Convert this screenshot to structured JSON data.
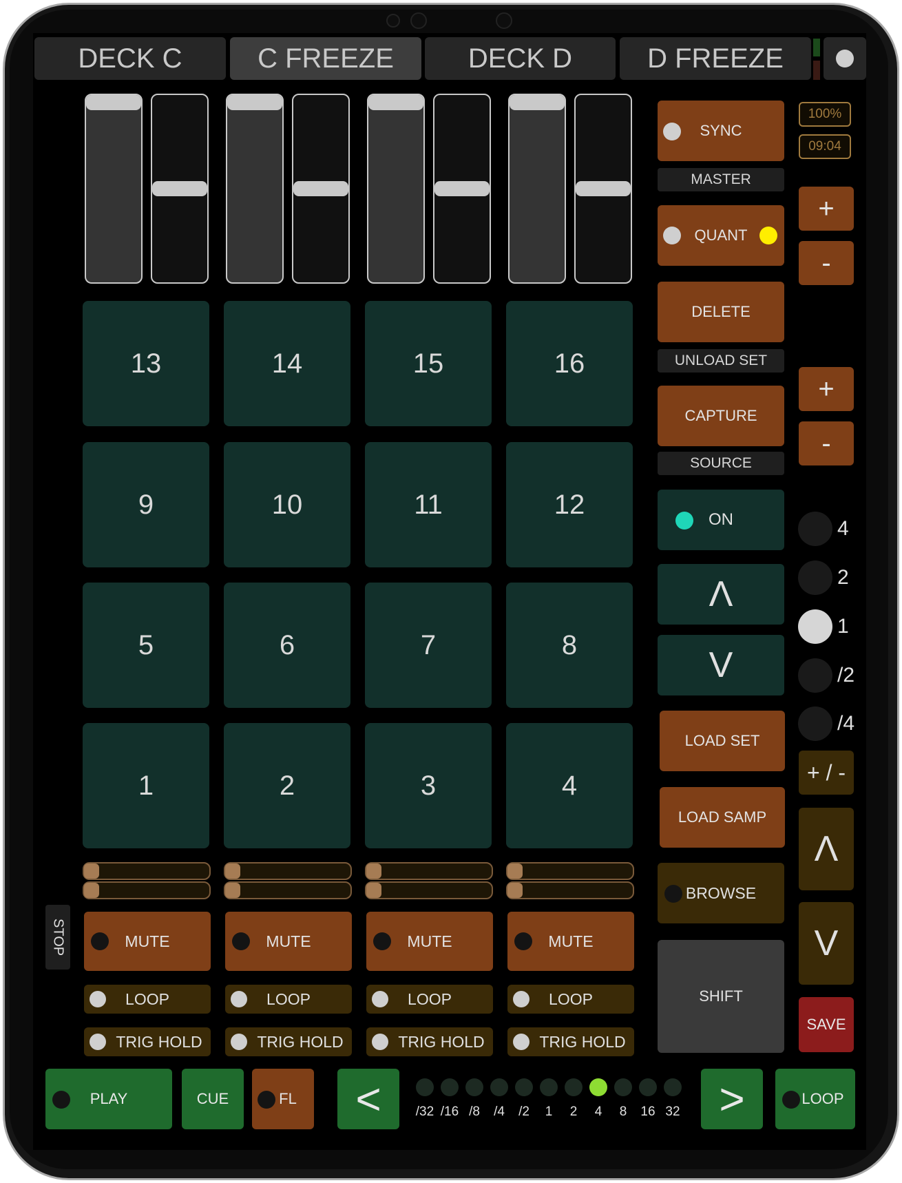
{
  "tabs": [
    {
      "label": "DECK C",
      "active": false
    },
    {
      "label": "C FREEZE",
      "active": true
    },
    {
      "label": "DECK D",
      "active": false
    },
    {
      "label": "D FREEZE",
      "active": false
    }
  ],
  "faders": {
    "levels": [
      1.0,
      0.5,
      1.0,
      0.5,
      1.0,
      0.5,
      1.0,
      0.5
    ]
  },
  "pads": {
    "rows": [
      [
        "13",
        "14",
        "15",
        "16"
      ],
      [
        "9",
        "10",
        "11",
        "12"
      ],
      [
        "5",
        "6",
        "7",
        "8"
      ],
      [
        "1",
        "2",
        "3",
        "4"
      ]
    ]
  },
  "slots": {
    "mute_label": "MUTE",
    "loop_label": "LOOP",
    "trig_hold_label": "TRIG HOLD",
    "stop_label": "STOP"
  },
  "right_panel": {
    "sync": "SYNC",
    "master": "MASTER",
    "quant": "QUANT",
    "delete": "DELETE",
    "unload_set": "UNLOAD SET",
    "capture": "CAPTURE",
    "source": "SOURCE",
    "on": "ON",
    "up_arrow": "Λ",
    "down_arrow": "V",
    "load_set": "LOAD SET",
    "load_samp": "LOAD SAMP",
    "browse": "BROWSE",
    "shift": "SHIFT"
  },
  "side_column": {
    "volume": "100%",
    "time": "09:04",
    "plus": "+",
    "minus": "-",
    "beat_options": [
      "4",
      "2",
      "1",
      "/2",
      "/4"
    ],
    "beat_selected": "1",
    "plus_minus": "+ / -",
    "up_arrow": "Λ",
    "down_arrow": "V",
    "save": "SAVE"
  },
  "transport": {
    "play": "PLAY",
    "cue": "CUE",
    "fl": "FL",
    "prev": "<",
    "next": ">",
    "loop": "LOOP",
    "loop_sizes": [
      "/32",
      "/16",
      "/8",
      "/4",
      "/2",
      "1",
      "2",
      "4",
      "8",
      "16",
      "32"
    ],
    "loop_selected": "4"
  },
  "colors": {
    "pad": "#12302b",
    "orange": "#7f3f17",
    "brown": "#3a2a07",
    "green": "#1f6b2d",
    "save": "#8c1c1c",
    "active_green": "#8edc33",
    "quant_yellow": "#ffee00",
    "on_cyan": "#1fd6b8"
  }
}
